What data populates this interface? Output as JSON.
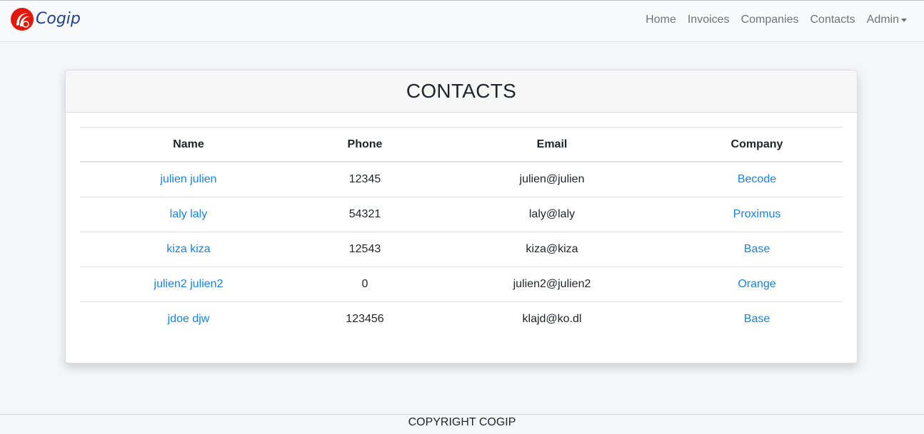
{
  "brand": {
    "name": "Cogip",
    "logo_icon": "cogip-logo-icon",
    "logo_color": "#e3170a"
  },
  "nav": {
    "items": [
      {
        "label": "Home"
      },
      {
        "label": "Invoices"
      },
      {
        "label": "Companies"
      },
      {
        "label": "Contacts"
      },
      {
        "label": "Admin",
        "dropdown": true
      }
    ]
  },
  "card": {
    "title": "CONTACTS"
  },
  "table": {
    "headers": [
      "Name",
      "Phone",
      "Email",
      "Company"
    ],
    "rows": [
      {
        "name": "julien julien",
        "phone": "12345",
        "email": "julien@julien",
        "company": "Becode"
      },
      {
        "name": "laly laly",
        "phone": "54321",
        "email": "laly@laly",
        "company": "Proximus"
      },
      {
        "name": "kiza kiza",
        "phone": "12543",
        "email": "kiza@kiza",
        "company": "Base"
      },
      {
        "name": "julien2 julien2",
        "phone": "0",
        "email": "julien2@julien2",
        "company": "Orange"
      },
      {
        "name": "jdoe djw",
        "phone": "123456",
        "email": "klajd@ko.dl",
        "company": "Base"
      }
    ]
  },
  "footer": {
    "text": "COPYRIGHT COGIP"
  },
  "colors": {
    "link": "#1583e9",
    "nav_text": "#6f7378",
    "brand_text": "#1f3f8f"
  }
}
